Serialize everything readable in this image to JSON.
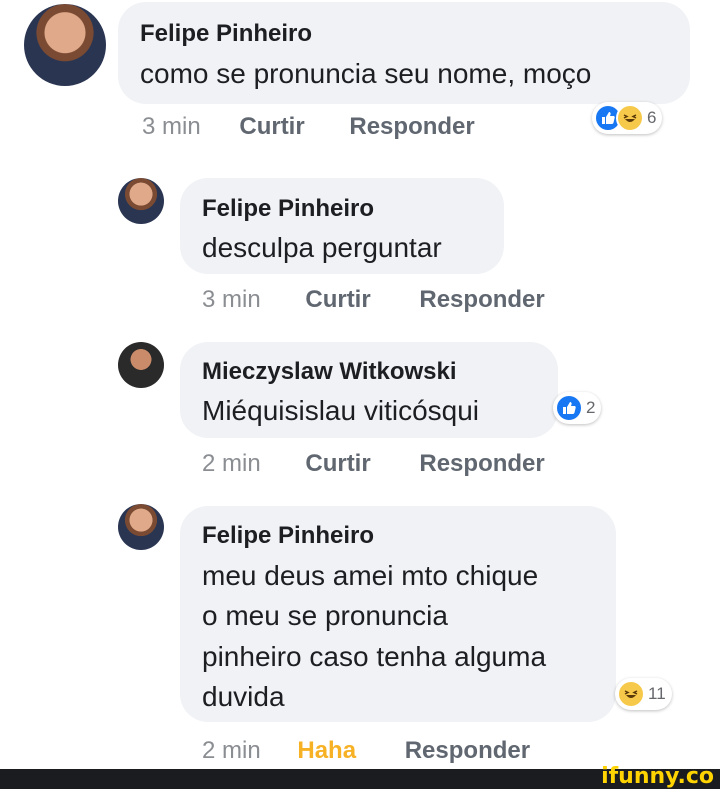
{
  "comments": [
    {
      "author": "Felipe Pinheiro",
      "lines": [
        "como se pronuncia seu nome, moço"
      ],
      "time": "3 min",
      "like": "Curtir",
      "reply": "Responder",
      "reactions": {
        "icons": [
          "like",
          "haha"
        ],
        "count": "6"
      }
    },
    {
      "author": "Felipe Pinheiro",
      "lines": [
        "desculpa perguntar"
      ],
      "time": "3 min",
      "like": "Curtir",
      "reply": "Responder"
    },
    {
      "author": "Mieczyslaw Witkowski",
      "lines": [
        "Miéquisislau viticósqui"
      ],
      "time": "2 min",
      "like": "Curtir",
      "reply": "Responder",
      "reactions": {
        "icons": [
          "like"
        ],
        "count": "2"
      }
    },
    {
      "author": "Felipe Pinheiro",
      "lines": [
        "meu deus amei mto chique",
        "o meu se pronuncia",
        "pinheiro caso tenha alguma",
        "duvida"
      ],
      "time": "2 min",
      "like": "Haha",
      "reply": "Responder",
      "reactions": {
        "icons": [
          "haha"
        ],
        "count": "11"
      }
    }
  ],
  "watermark": "ifunny.co",
  "colors": {
    "like_blue": "#1877f2",
    "haha_yellow": "#f7b125",
    "bubble": "#f0f2f5"
  }
}
